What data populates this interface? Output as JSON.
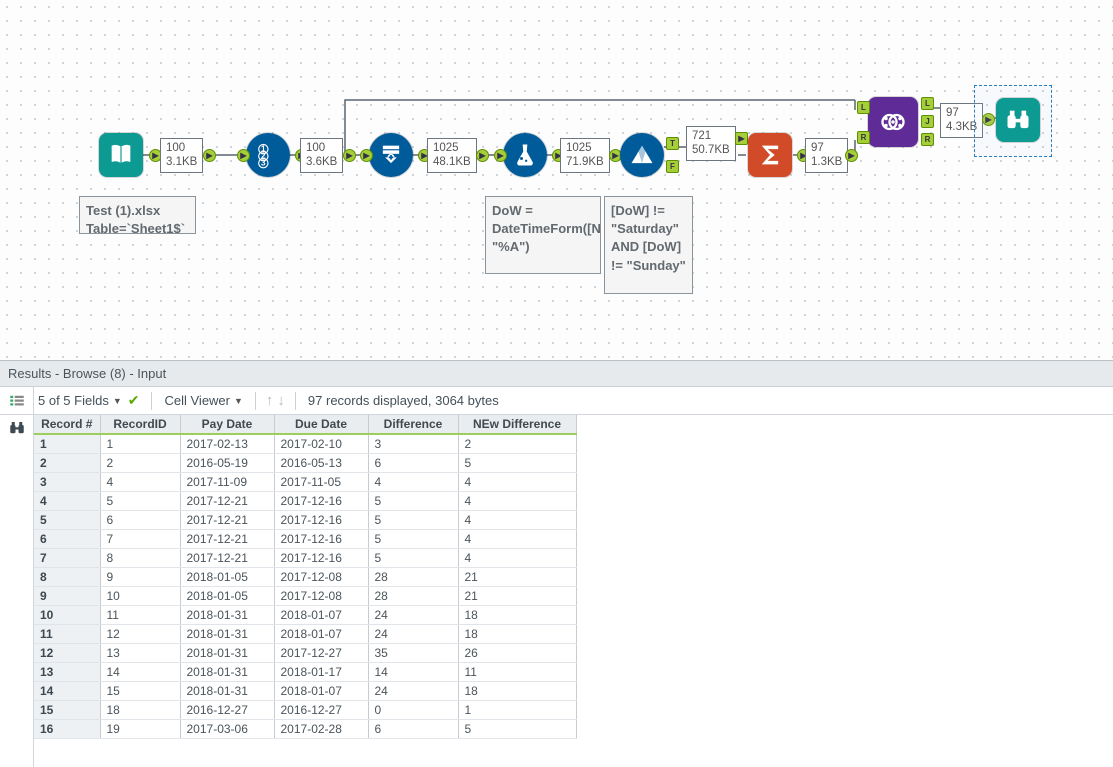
{
  "canvas": {
    "input_annotation": "Test (1).xlsx\nTable=`Sheet1$`",
    "formula_annotation": "DoW = DateTimeForm([NewDate], \"%A\")",
    "filter_annotation": "[DoW] != \"Saturday\" AND [DoW] != \"Sunday\"",
    "rec1": {
      "n": "100",
      "kb": "3.1KB"
    },
    "rec2": {
      "n": "100",
      "kb": "3.6KB"
    },
    "rec3": {
      "n": "1025",
      "kb": "48.1KB"
    },
    "rec4": {
      "n": "1025",
      "kb": "71.9KB"
    },
    "rec5": {
      "n": "721",
      "kb": "50.7KB"
    },
    "rec6": {
      "n": "97",
      "kb": "1.3KB"
    },
    "rec7": {
      "n": "97",
      "kb": "4.3KB"
    }
  },
  "results": {
    "title": "Results - Browse (8) - Input",
    "fields_text": "5 of 5 Fields",
    "cell_viewer": "Cell Viewer",
    "status": "97 records displayed, 3064 bytes",
    "columns": [
      "Record #",
      "RecordID",
      "Pay Date",
      "Due Date",
      "Difference",
      "NEw Difference"
    ],
    "rows": [
      {
        "r": "1",
        "id": "1",
        "pay": "2017-02-13",
        "due": "2017-02-10",
        "d": "3",
        "nd": "2"
      },
      {
        "r": "2",
        "id": "2",
        "pay": "2016-05-19",
        "due": "2016-05-13",
        "d": "6",
        "nd": "5"
      },
      {
        "r": "3",
        "id": "4",
        "pay": "2017-11-09",
        "due": "2017-11-05",
        "d": "4",
        "nd": "4"
      },
      {
        "r": "4",
        "id": "5",
        "pay": "2017-12-21",
        "due": "2017-12-16",
        "d": "5",
        "nd": "4"
      },
      {
        "r": "5",
        "id": "6",
        "pay": "2017-12-21",
        "due": "2017-12-16",
        "d": "5",
        "nd": "4"
      },
      {
        "r": "6",
        "id": "7",
        "pay": "2017-12-21",
        "due": "2017-12-16",
        "d": "5",
        "nd": "4"
      },
      {
        "r": "7",
        "id": "8",
        "pay": "2017-12-21",
        "due": "2017-12-16",
        "d": "5",
        "nd": "4"
      },
      {
        "r": "8",
        "id": "9",
        "pay": "2018-01-05",
        "due": "2017-12-08",
        "d": "28",
        "nd": "21"
      },
      {
        "r": "9",
        "id": "10",
        "pay": "2018-01-05",
        "due": "2017-12-08",
        "d": "28",
        "nd": "21"
      },
      {
        "r": "10",
        "id": "11",
        "pay": "2018-01-31",
        "due": "2018-01-07",
        "d": "24",
        "nd": "18"
      },
      {
        "r": "11",
        "id": "12",
        "pay": "2018-01-31",
        "due": "2018-01-07",
        "d": "24",
        "nd": "18"
      },
      {
        "r": "12",
        "id": "13",
        "pay": "2018-01-31",
        "due": "2017-12-27",
        "d": "35",
        "nd": "26"
      },
      {
        "r": "13",
        "id": "14",
        "pay": "2018-01-31",
        "due": "2018-01-17",
        "d": "14",
        "nd": "11"
      },
      {
        "r": "14",
        "id": "15",
        "pay": "2018-01-31",
        "due": "2018-01-07",
        "d": "24",
        "nd": "18"
      },
      {
        "r": "15",
        "id": "18",
        "pay": "2016-12-27",
        "due": "2016-12-27",
        "d": "0",
        "nd": "1"
      },
      {
        "r": "16",
        "id": "19",
        "pay": "2017-03-06",
        "due": "2017-02-28",
        "d": "6",
        "nd": "5"
      }
    ]
  }
}
